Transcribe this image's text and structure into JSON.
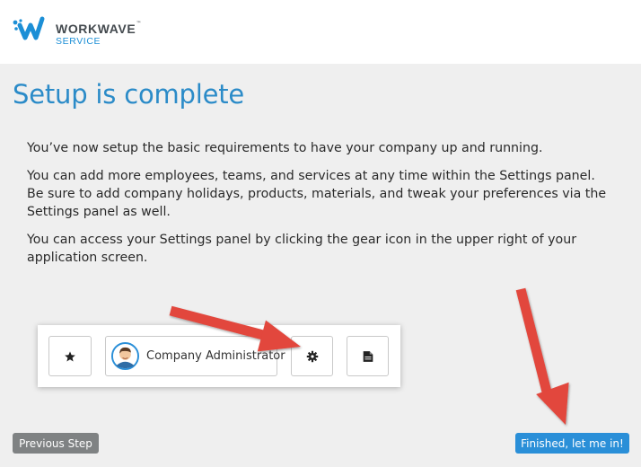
{
  "brand": {
    "name": "WORKWAVE",
    "trademark": "™",
    "product": "SERVICE",
    "primary_color": "#1c8fd6"
  },
  "page": {
    "title": "Setup is complete",
    "paragraphs": [
      "You’ve now setup the basic requirements to have your company up and running.",
      "You can add more employees, teams, and services at any time within the Settings panel. Be sure to add company holidays, products, materials, and tweak your preferences via the Settings panel as well.",
      "You can access your Settings panel by clicking the gear icon in the upper right of your application screen."
    ]
  },
  "illustration": {
    "user_label": "Company Administrator",
    "icons": [
      "star-icon",
      "avatar",
      "gear-icon",
      "document-icon"
    ],
    "arrow_color": "#e2463c"
  },
  "footer": {
    "previous_label": "Previous Step",
    "finish_label": "Finished, let me in!",
    "previous_color": "#7f8283",
    "finish_color": "#2a8fd8"
  }
}
